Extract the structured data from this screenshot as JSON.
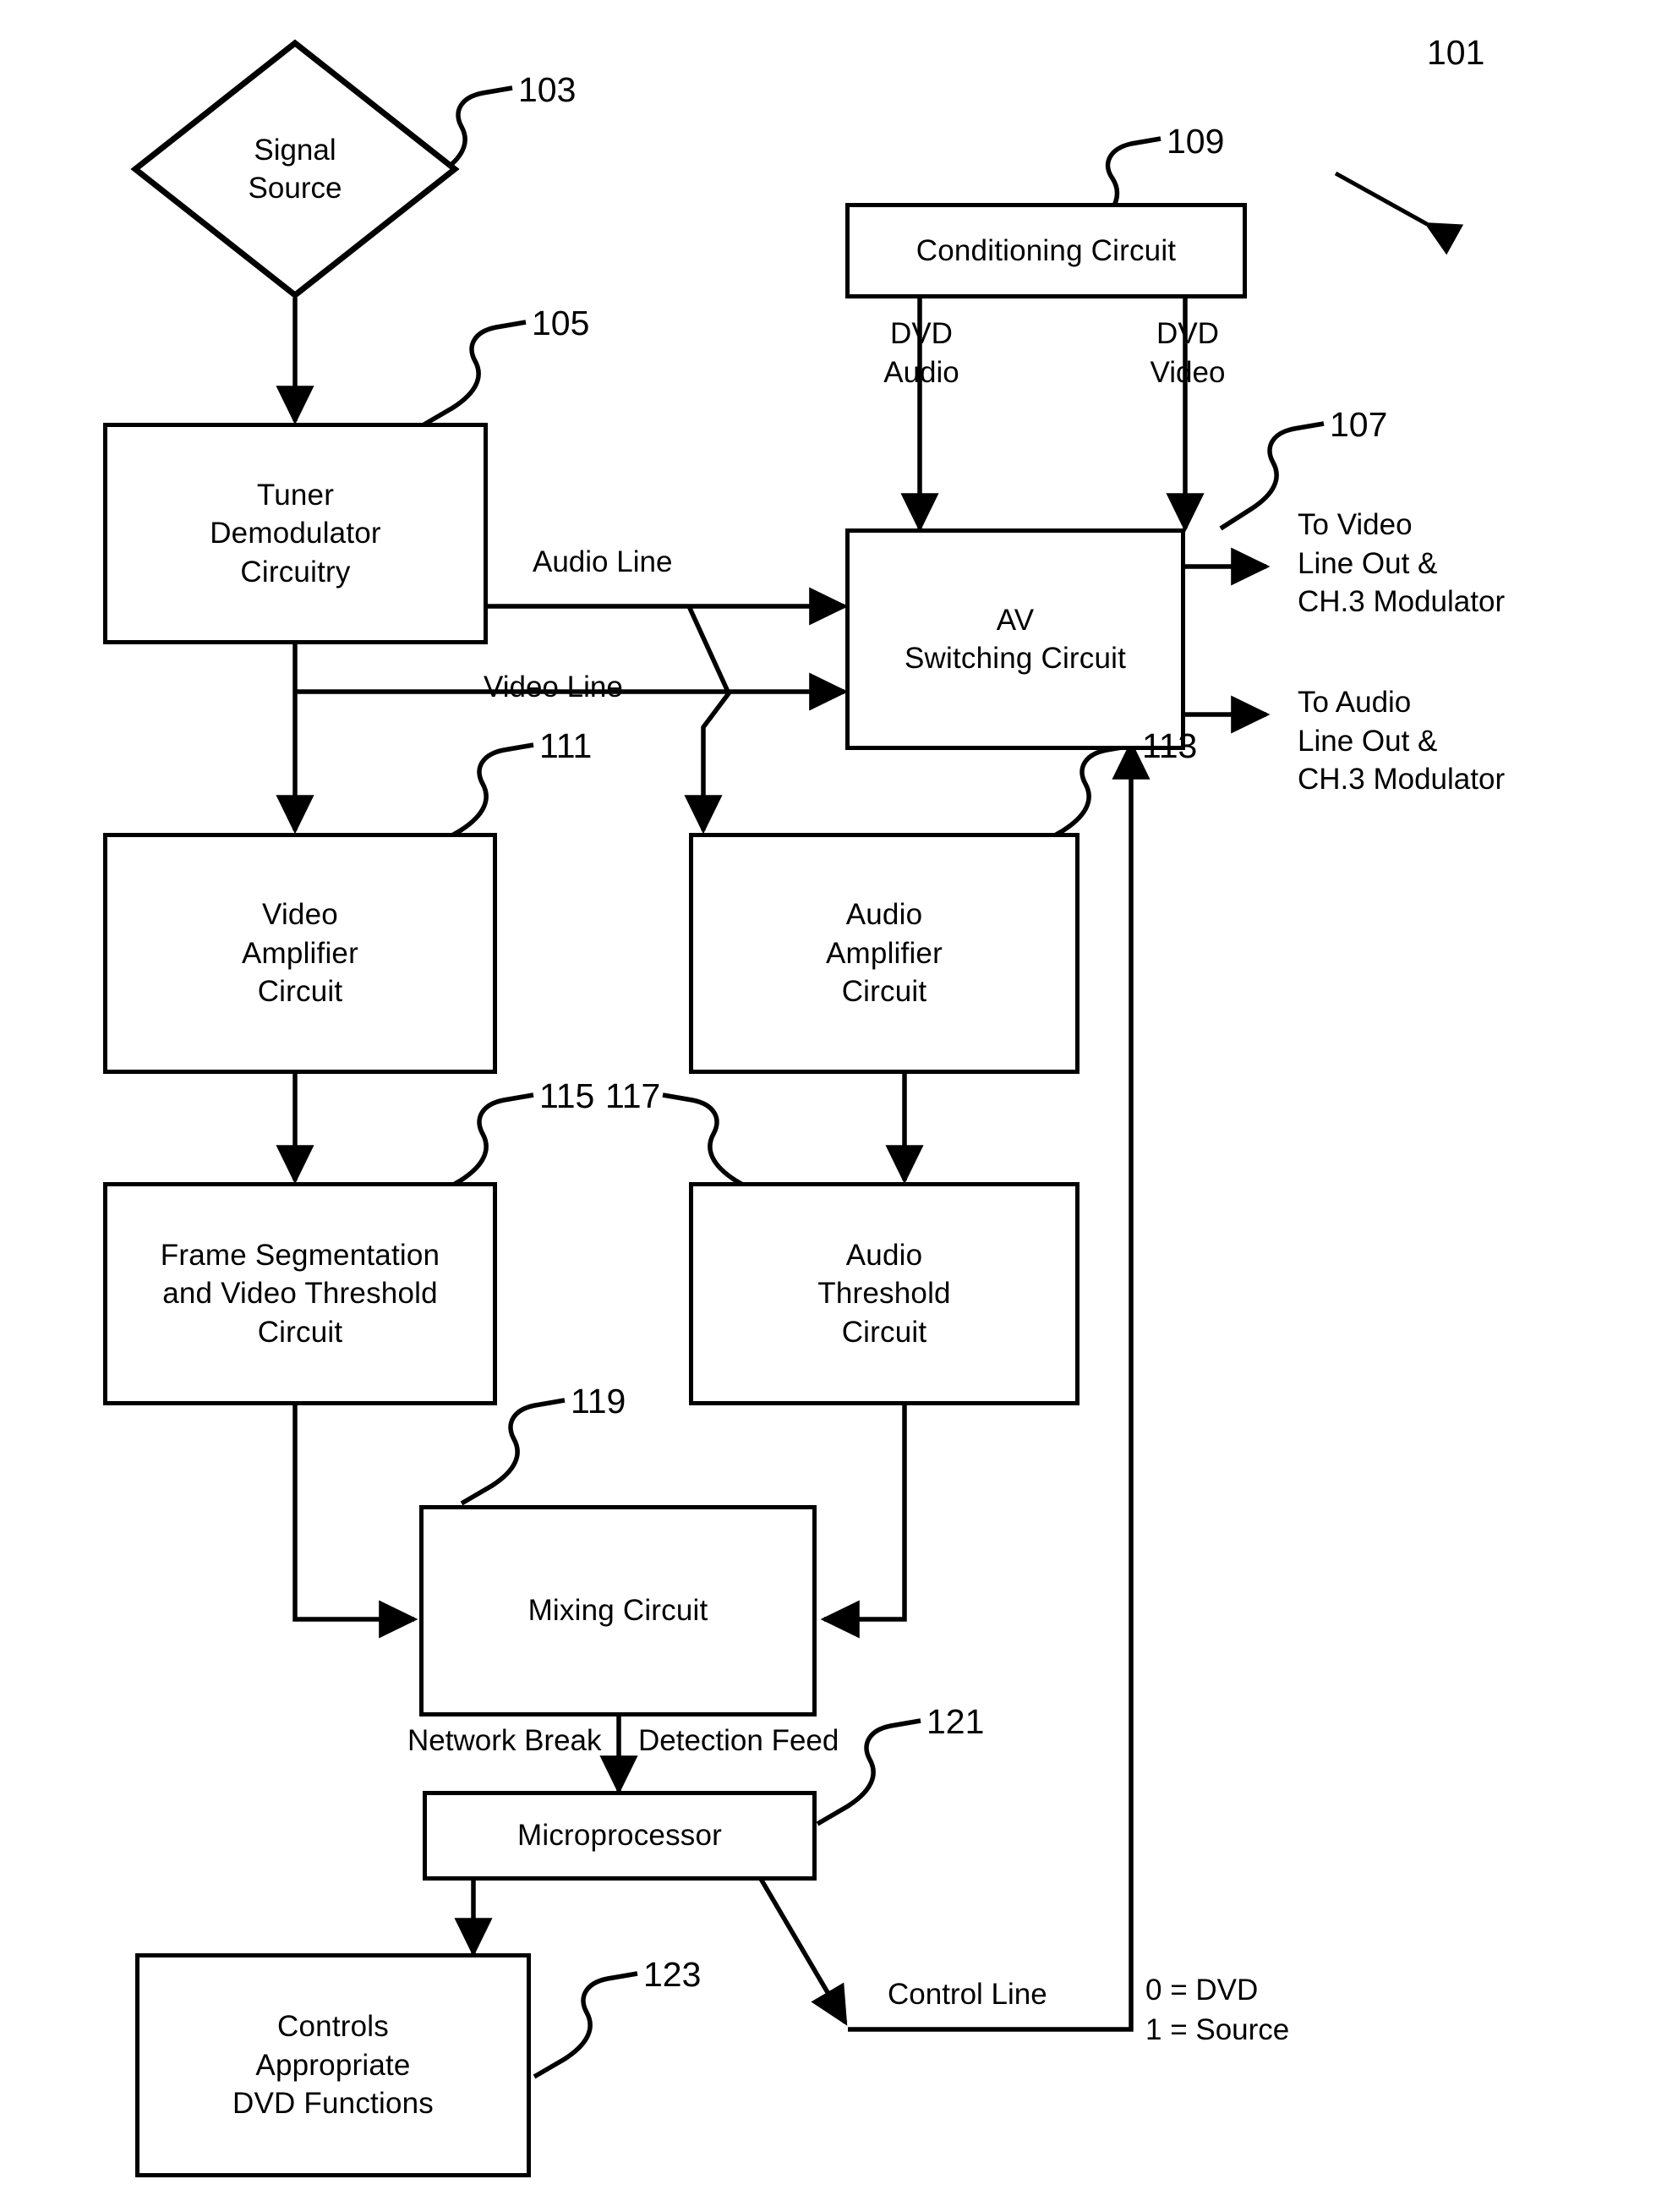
{
  "figure": {
    "title_ref": "101",
    "nodes": {
      "signal_source": "Signal\nSource",
      "tuner": "Tuner\nDemodulator\nCircuitry",
      "conditioning": "Conditioning Circuit",
      "av_switching": "AV\nSwitching Circuit",
      "video_amp": "Video\nAmplifier\nCircuit",
      "audio_amp": "Audio\nAmplifier\nCircuit",
      "frame_seg": "Frame Segmentation\nand Video Threshold\nCircuit",
      "audio_thresh": "Audio\nThreshold\nCircuit",
      "mixing": "Mixing Circuit",
      "microprocessor": "Microprocessor",
      "controls": "Controls\nAppropriate\nDVD Functions"
    },
    "refs": {
      "signal_source": "103",
      "tuner": "105",
      "conditioning": "109",
      "av_switching": "107",
      "video_amp": "111",
      "audio_amp": "113",
      "frame_seg": "115",
      "audio_thresh": "117",
      "mixing": "119",
      "microprocessor": "121",
      "controls": "123"
    },
    "labels": {
      "dvd_audio": "DVD\nAudio",
      "dvd_video": "DVD\nVideo",
      "audio_line": "Audio Line",
      "video_line": "Video Line",
      "to_video_out": "To Video\nLine Out &\nCH.3 Modulator",
      "to_audio_out": "To Audio\nLine Out &\nCH.3 Modulator",
      "network_break": "Network Break",
      "detection_feed": "Detection Feed",
      "control_line": "Control Line",
      "legend_0": "0 = DVD",
      "legend_1": "1 = Source"
    }
  }
}
